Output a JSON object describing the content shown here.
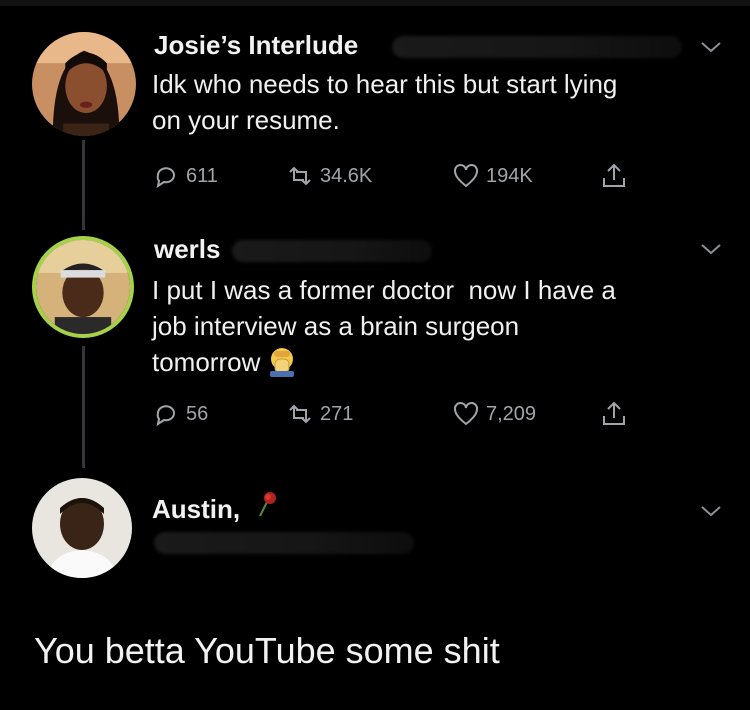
{
  "tweets": [
    {
      "name": "Josie’s Interlude",
      "lines": [
        "Idk who needs to hear this but start lying",
        "on your resume."
      ],
      "replies": "611",
      "retweets": "34.6K",
      "likes": "194K"
    },
    {
      "name": "werls",
      "lines": [
        "I put I was a former doctor  now I have a",
        "job interview as a brain surgeon",
        "tomorrow"
      ],
      "replies": "56",
      "retweets": "271",
      "likes": "7,209"
    },
    {
      "name": "Austin,"
    }
  ],
  "reply_text": "You betta YouTube some shit",
  "icons": {
    "reply": "reply-icon",
    "retweet": "retweet-icon",
    "like": "heart-icon",
    "share": "share-icon",
    "more": "chevron-down-icon",
    "emoji": "face-palm-emoji",
    "rose": "wilted-rose-emoji"
  },
  "colors": {
    "background": "#000000",
    "icon": "#a0a5aa",
    "thread_line": "#333639",
    "avatar_ring": "#a5d24a"
  }
}
